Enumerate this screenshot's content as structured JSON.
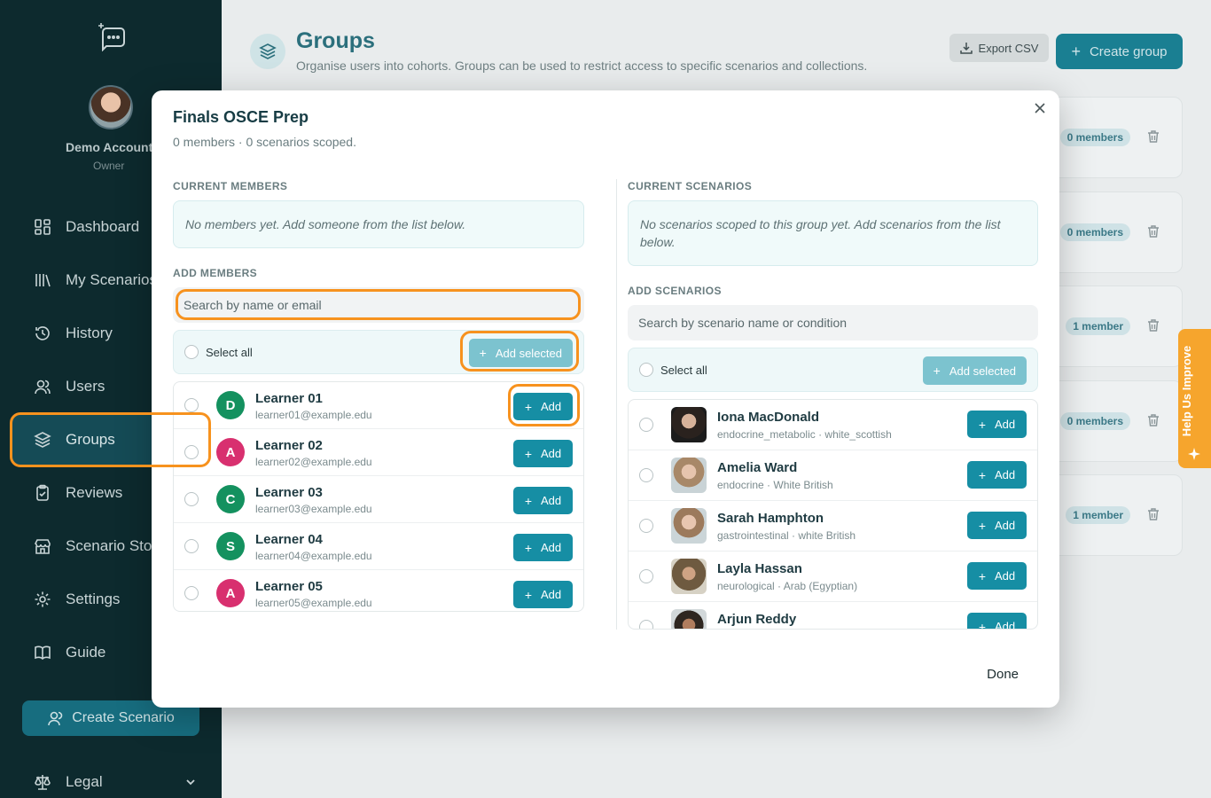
{
  "sidebar": {
    "account_name": "Demo Account",
    "account_role": "Owner",
    "items": [
      {
        "label": "Dashboard",
        "icon": "dashboard-icon"
      },
      {
        "label": "My Scenarios",
        "icon": "library-icon"
      },
      {
        "label": "History",
        "icon": "history-icon"
      },
      {
        "label": "Users",
        "icon": "users-icon"
      },
      {
        "label": "Groups",
        "icon": "layers-icon"
      },
      {
        "label": "Reviews",
        "icon": "clipboard-icon"
      },
      {
        "label": "Scenario Store",
        "icon": "store-icon"
      },
      {
        "label": "Settings",
        "icon": "gear-icon"
      },
      {
        "label": "Guide",
        "icon": "book-icon"
      }
    ],
    "create_scenario": "Create Scenario",
    "legal": "Legal"
  },
  "page": {
    "title": "Groups",
    "subtitle": "Organise users into cohorts. Groups can be used to restrict access to specific scenarios and collections.",
    "export_label": "Export CSV",
    "create_group_label": "Create group",
    "cards": [
      {
        "badge": "0 members"
      },
      {
        "badge": "0 members"
      },
      {
        "badge": "1 member"
      },
      {
        "badge": "0 members"
      },
      {
        "badge": "1 member"
      }
    ]
  },
  "help_tab": "Help Us Improve",
  "modal": {
    "title": "Finals OSCE Prep",
    "subtitle": "0 members · 0 scenarios scoped.",
    "members": {
      "current_label": "CURRENT MEMBERS",
      "empty_text": "No members yet. Add someone from the list below.",
      "add_label": "ADD MEMBERS",
      "search_placeholder": "Search by name or email",
      "select_all": "Select all",
      "add_selected": "Add selected",
      "add": "Add",
      "rows": [
        {
          "initial": "D",
          "name": "Learner 01",
          "email": "learner01@example.edu",
          "color": "#14915f"
        },
        {
          "initial": "A",
          "name": "Learner 02",
          "email": "learner02@example.edu",
          "color": "#d8306f"
        },
        {
          "initial": "C",
          "name": "Learner 03",
          "email": "learner03@example.edu",
          "color": "#14915f"
        },
        {
          "initial": "S",
          "name": "Learner 04",
          "email": "learner04@example.edu",
          "color": "#14915f"
        },
        {
          "initial": "A",
          "name": "Learner 05",
          "email": "learner05@example.edu",
          "color": "#d8306f"
        }
      ]
    },
    "scenarios": {
      "current_label": "CURRENT SCENARIOS",
      "empty_text": "No scenarios scoped to this group yet. Add scenarios from the list below.",
      "add_label": "ADD SCENARIOS",
      "search_placeholder": "Search by scenario name or condition",
      "select_all": "Select all",
      "add_selected": "Add selected",
      "add": "Add",
      "rows": [
        {
          "name": "Iona MacDonald",
          "meta": "endocrine_metabolic · white_scottish"
        },
        {
          "name": "Amelia Ward",
          "meta": "endocrine · White British"
        },
        {
          "name": "Sarah Hamphton",
          "meta": "gastrointestinal · white British"
        },
        {
          "name": "Layla Hassan",
          "meta": "neurological · Arab (Egyptian)"
        },
        {
          "name": "Arjun Reddy",
          "meta": ""
        }
      ]
    },
    "done": "Done"
  }
}
